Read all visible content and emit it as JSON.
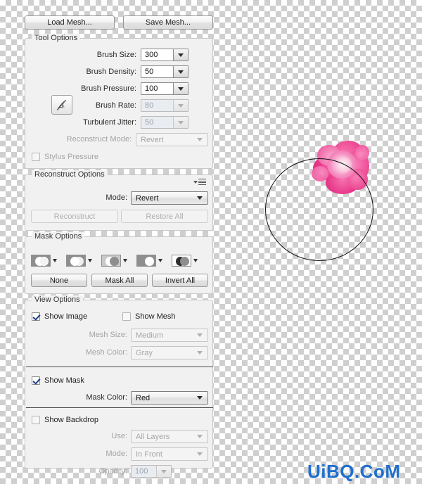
{
  "panel": {
    "load_mesh": "Load Mesh...",
    "save_mesh": "Save Mesh..."
  },
  "tool_options": {
    "title": "Tool Options",
    "tool_icon": "stylus-pressure-icon",
    "fields": [
      {
        "label": "Brush Size:",
        "value": "300",
        "enabled": true
      },
      {
        "label": "Brush Density:",
        "value": "50",
        "enabled": true
      },
      {
        "label": "Brush Pressure:",
        "value": "100",
        "enabled": true
      },
      {
        "label": "Brush Rate:",
        "value": "80",
        "enabled": false
      },
      {
        "label": "Turbulent Jitter:",
        "value": "50",
        "enabled": false
      }
    ],
    "reconstruct_mode_label": "Reconstruct Mode:",
    "reconstruct_mode_value": "Revert",
    "stylus_pressure_label": "Stylus Pressure",
    "stylus_pressure_checked": false
  },
  "reconstruct_options": {
    "title": "Reconstruct Options",
    "menu_icon": "panel-menu-icon",
    "mode_label": "Mode:",
    "mode_value": "Revert",
    "reconstruct_button": "Reconstruct",
    "restore_all_button": "Restore All"
  },
  "mask_options": {
    "title": "Mask Options",
    "icons": [
      "mask-replace-selection-icon",
      "mask-add-to-selection-icon",
      "mask-subtract-from-selection-icon",
      "mask-intersect-with-selection-icon",
      "mask-invert-selection-icon"
    ],
    "none_button": "None",
    "mask_all_button": "Mask All",
    "invert_all_button": "Invert All"
  },
  "view_options": {
    "title": "View Options",
    "show_image_label": "Show Image",
    "show_image_checked": true,
    "show_mesh_label": "Show Mesh",
    "show_mesh_checked": false,
    "mesh_size_label": "Mesh Size:",
    "mesh_size_value": "Medium",
    "mesh_color_label": "Mesh Color:",
    "mesh_color_value": "Gray",
    "show_mask_label": "Show Mask",
    "show_mask_checked": true,
    "mask_color_label": "Mask Color:",
    "mask_color_value": "Red",
    "show_backdrop_label": "Show Backdrop",
    "show_backdrop_checked": false,
    "use_label": "Use:",
    "use_value": "All Layers",
    "backdrop_mode_label": "Mode:",
    "backdrop_mode_value": "In Front",
    "opacity_label": "Opacity:",
    "opacity_value": "100"
  },
  "canvas": {
    "brush_cursor": "brush-cursor-circle",
    "image_subject": "pink-peony-flower"
  },
  "watermark": {
    "text": "UiBQ.CoM",
    "color": "#1f6fd0"
  }
}
